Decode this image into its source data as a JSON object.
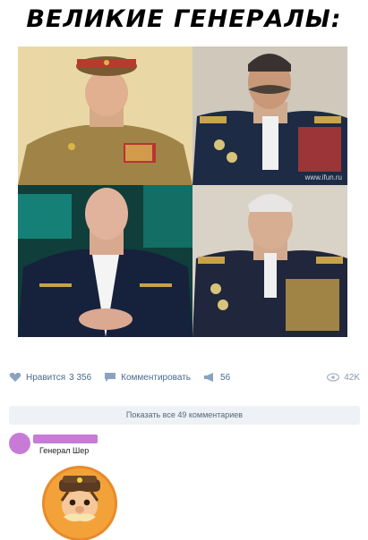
{
  "post": {
    "title": "ВЕЛИКИЕ ГЕНЕРАЛЫ:",
    "watermark": "www.ifun.ru"
  },
  "actions": {
    "like_label": "Нравится",
    "like_count": "3 356",
    "comment_label": "Комментировать",
    "share_count": "56",
    "views_count": "42K"
  },
  "comments": {
    "show_all_label": "Показать все 49 комментариев",
    "first": {
      "text": "Генерал Шер"
    }
  },
  "colors": {
    "link": "#4a6a91",
    "redact": "#c77bd7",
    "sticker": "#e98a2a"
  }
}
